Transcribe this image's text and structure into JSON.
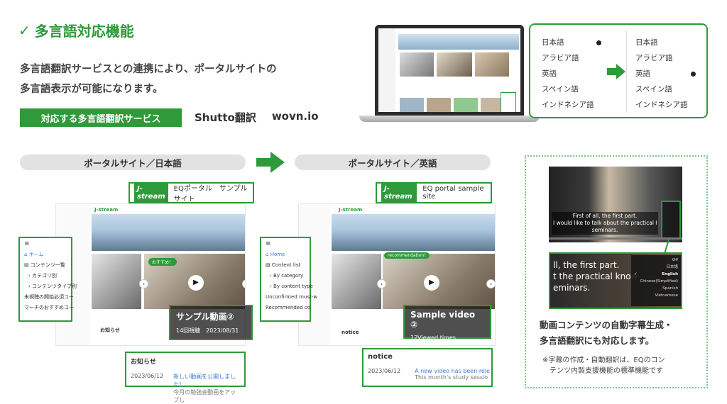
{
  "title": "多言語対応機能",
  "description": [
    "多言語翻訳サービスとの連携により、ポータルサイトの",
    "多言語表示が可能になります。"
  ],
  "services": {
    "label": "対応する多言語翻訳サービス",
    "names": [
      "Shutto翻訳",
      "wovn.io"
    ]
  },
  "lang_panel": {
    "before": [
      "日本語",
      "アラビア語",
      "英語",
      "スペイン語",
      "インドネシア語"
    ],
    "after": [
      "日本語",
      "アラビア語",
      "英語",
      "スペイン語",
      "インドネシア語"
    ],
    "before_selected": "日本語",
    "after_selected": "英語"
  },
  "left_screen": {
    "header": "ポータルサイト／日本語",
    "logo": "J-stream",
    "site_title": "EQポータル　サンプルサイト",
    "nav": [
      "ホーム",
      "コンテンツ一覧",
      "カテゴリ別",
      "コンテンツタイプ別",
      "未視聴の開始必須コー",
      "マーチのおすすめコー"
    ],
    "video_title": "サンプル動画②",
    "video_meta": "14回視聴　2023/08/31",
    "badge": "おすすめ！",
    "notice_heading": "お知らせ",
    "notice_date": "2023/06/12",
    "notice_title": "新しい動画を公開しました！",
    "notice_body": "今月の勉強会動画をアップし"
  },
  "right_screen": {
    "header": "ポータルサイト／英語",
    "logo": "J-stream",
    "site_title": "EQ portal sample site",
    "nav": [
      "Home",
      "Content list",
      "By category",
      "By content type",
      "Unconfirmed must-w",
      "Recommended content"
    ],
    "video_title": "Sample video ②",
    "video_meta": "12Viewed times　2023/08/31",
    "badge": "recommendation!",
    "notice_heading": "notice",
    "notice_date": "2023/06/12",
    "notice_title": "A new video has been rele",
    "notice_body": "This month's study sessio"
  },
  "subtitle_demo": {
    "caption1": [
      "First of all, the first part.",
      "I would like to talk about the practical kno",
      "seminars."
    ],
    "caption2": [
      "ll, the first part.",
      "t the practical know-",
      "eminars."
    ],
    "menu": [
      "Off",
      "日本語",
      "English",
      "Chinese(Simplified)",
      "Spanish",
      "Vietnamese"
    ],
    "menu_selected": "English",
    "description": [
      "動画コンテンツの自動字幕生成・",
      "多言語翻訳にも対応します。"
    ],
    "note": [
      "※字幕の作成・自動翻訳は、EQのコン",
      "テンツ内製支援機能の標準機能です"
    ]
  },
  "colors": {
    "accent": "#2e9a3a",
    "pill": "#e2e2e2"
  }
}
